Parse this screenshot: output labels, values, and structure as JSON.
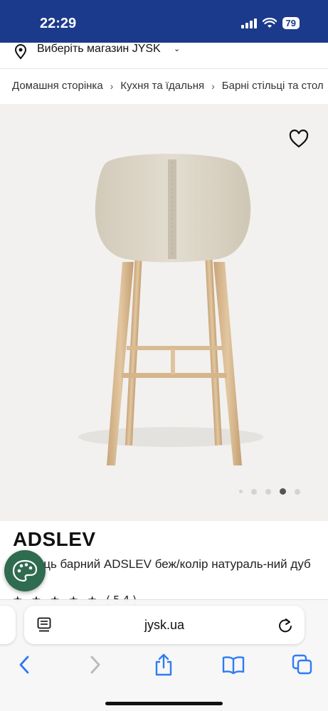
{
  "status_bar": {
    "time": "22:29",
    "battery": "79"
  },
  "store_selector": {
    "label": "Виберіть магазин JYSK"
  },
  "breadcrumb": {
    "items": [
      "Домашня сторінка",
      "Кухня та їдальня",
      "Барні стільці та стол"
    ]
  },
  "gallery": {
    "image_alt": "beige bar stool with oak legs, rear view",
    "dot_count": 5,
    "active_dot": 3
  },
  "product": {
    "name": "ADSLEV",
    "description": "Стілець барний ADSLEV беж/колір натураль-ний дуб",
    "rating_stars": "★ ★ ★ ★ ★",
    "review_count": "(54)"
  },
  "browser": {
    "url": "jysk.ua"
  },
  "colors": {
    "brand_blue": "#1b3a8c",
    "cookie_green": "#2f6b4f",
    "ios_blue": "#2f7bf6"
  },
  "icons": [
    "location-pin-icon",
    "chevron-down-icon",
    "chevron-right-icon",
    "heart-icon",
    "cookie-settings-icon",
    "reader-mode-icon",
    "reload-icon",
    "back-icon",
    "forward-icon",
    "share-icon",
    "bookmarks-icon",
    "tabs-icon"
  ]
}
